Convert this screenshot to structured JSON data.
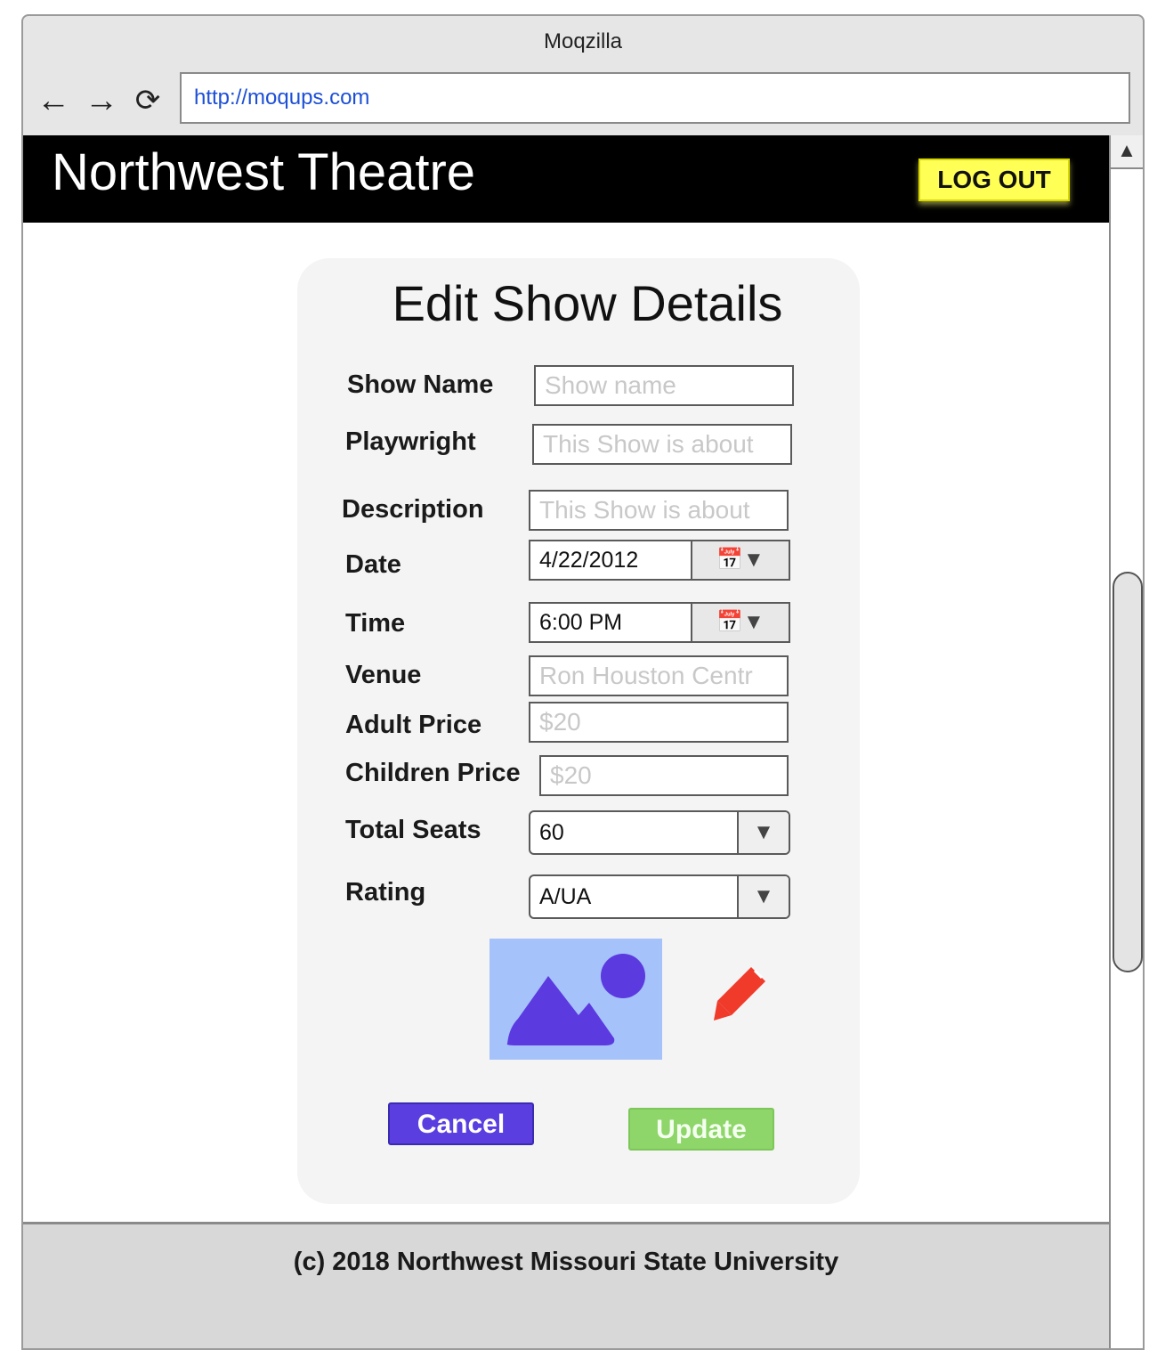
{
  "browser": {
    "title": "Moqzilla",
    "url": "http://moqups.com",
    "icons": [
      "back-arrow-icon",
      "forward-arrow-icon",
      "reload-icon"
    ]
  },
  "header": {
    "brand": "Northwest Theatre",
    "logout_label": "LOG OUT"
  },
  "form": {
    "title": "Edit Show Details",
    "fields": {
      "show_name": {
        "label": "Show Name",
        "placeholder": "Show name"
      },
      "playwright": {
        "label": "Playwright",
        "placeholder": "This Show is about"
      },
      "description": {
        "label": "Description",
        "placeholder": "This Show is about"
      },
      "date": {
        "label": "Date",
        "value": "4/22/2012"
      },
      "time": {
        "label": "Time",
        "value": "6:00 PM"
      },
      "venue": {
        "label": "Venue",
        "placeholder": "Ron Houston Centr"
      },
      "adult_price": {
        "label": "Adult Price",
        "placeholder": "$20"
      },
      "children_price": {
        "label": "Children Price",
        "placeholder": "$20"
      },
      "total_seats": {
        "label": "Total Seats",
        "value": "60"
      },
      "rating": {
        "label": "Rating",
        "value": "A/UA"
      }
    },
    "cancel_label": "Cancel",
    "update_label": "Update"
  },
  "footer": {
    "text": "(c) 2018 Northwest Missouri State University"
  },
  "colors": {
    "header_bg": "#000000",
    "logout_bg": "#ffff55",
    "cancel_bg": "#5a3ee0",
    "update_bg": "#8ed56a",
    "image_bg": "#a6c2fb",
    "image_fg": "#5b3ae0",
    "pencil": "#f03a2a"
  }
}
